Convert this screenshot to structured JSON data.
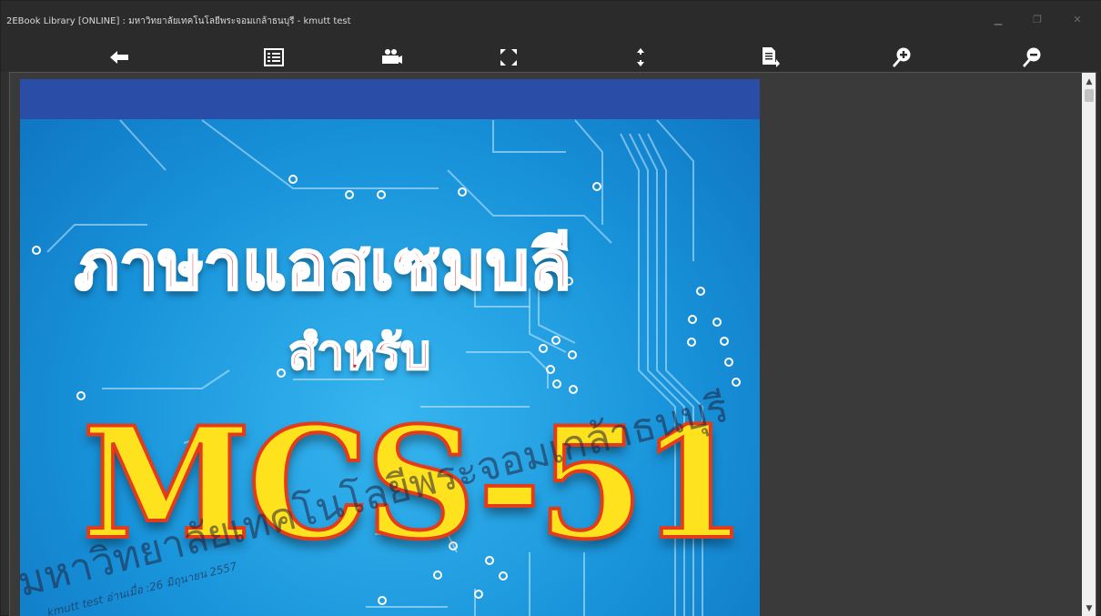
{
  "window": {
    "title": "2EBook Library [ONLINE] : มหาวิทยาลัยเทคโนโลยีพระจอมเกล้าธนบุรี  - kmutt test",
    "controls": [
      "minimize-icon",
      "maximize-icon",
      "close-icon"
    ]
  },
  "toolbar": {
    "buttons": [
      "back-arrow-icon",
      "table-of-contents-icon",
      "slideshow-camera-icon",
      "fullscreen-icon",
      "fit-height-icon",
      "export-page-icon",
      "zoom-in-icon",
      "zoom-out-icon"
    ]
  },
  "page": {
    "title_line1": "ภาษาแอสเซมบลี",
    "title_line2": "สำหรับ",
    "title_line3": "MCS-51",
    "watermark": "มหาวิทยาลัยเทคโนโลยีพระจอมเกล้าธนบุรี",
    "watermark_sub": "kmutt test อ่านเมื่อ :26 มิถุนายน 2557"
  },
  "colors": {
    "chrome": "#2b2b2b",
    "viewer_bg": "#3a3a3a",
    "cover_blue": "#1893da",
    "cover_band": "#2a4ea7",
    "title_red": "#e4222a",
    "mcs_yellow": "#ffe21e"
  }
}
